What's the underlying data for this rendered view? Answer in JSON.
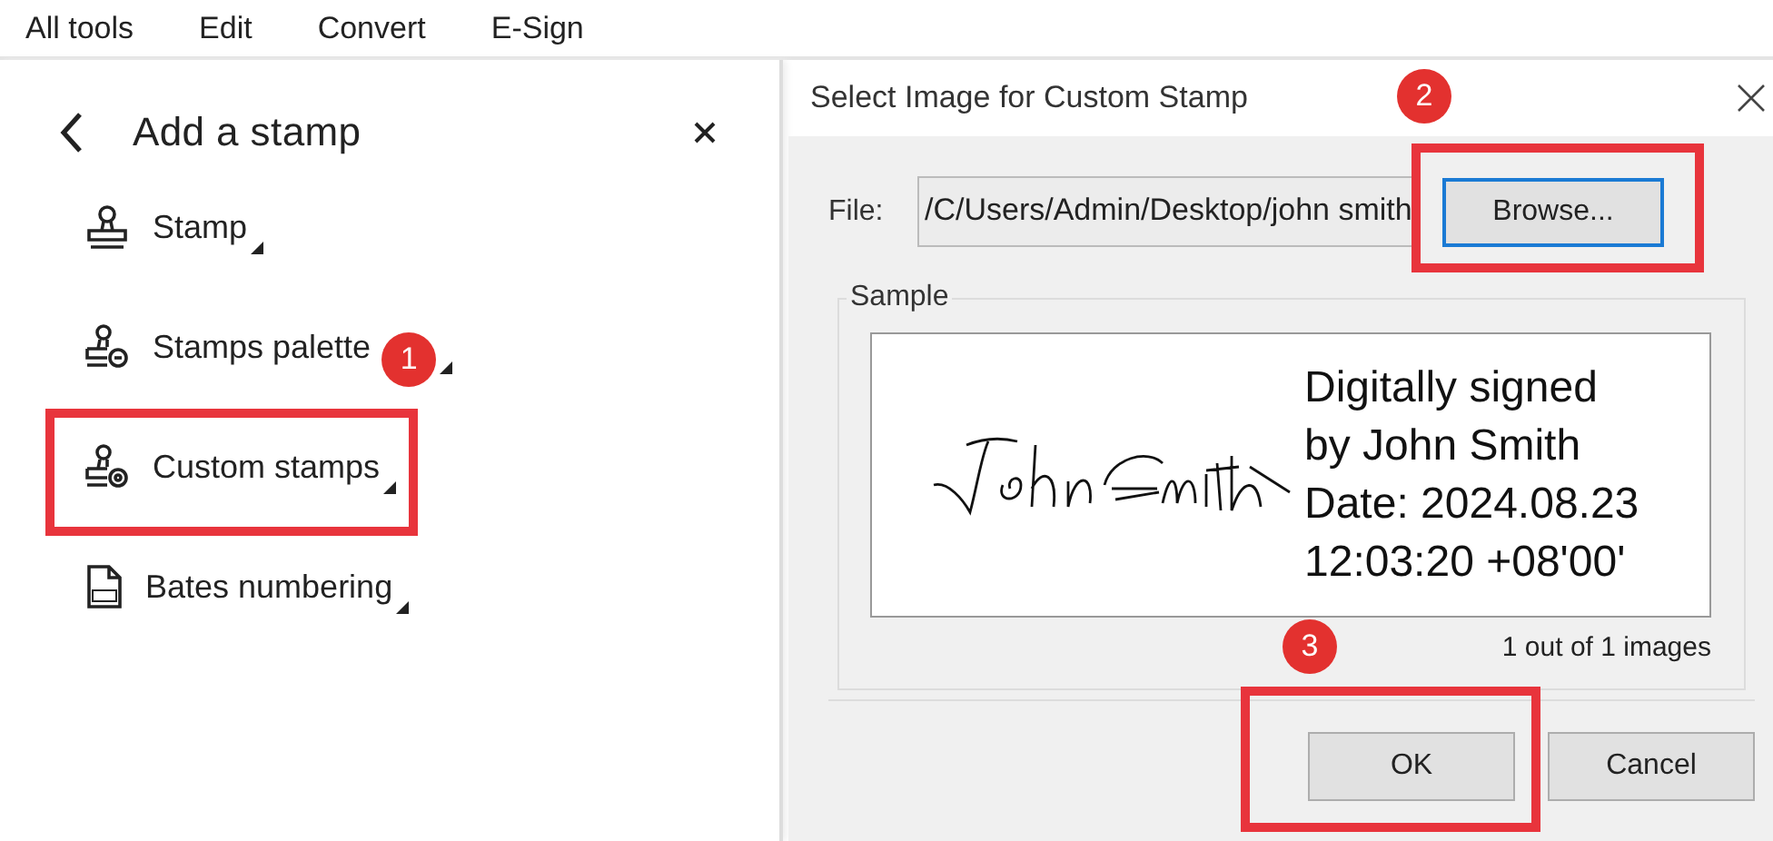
{
  "menu": [
    {
      "label": "All tools"
    },
    {
      "label": "Edit"
    },
    {
      "label": "Convert"
    },
    {
      "label": "E-Sign"
    }
  ],
  "panel": {
    "title": "Add a stamp",
    "items": [
      {
        "label": "Stamp",
        "kind": "stamp",
        "highlighted": false
      },
      {
        "label": "Stamps palette",
        "kind": "palette",
        "highlighted": false,
        "badge": "1"
      },
      {
        "label": "Custom stamps",
        "kind": "custom",
        "highlighted": true
      },
      {
        "label": "Bates numbering",
        "kind": "bates",
        "highlighted": false
      }
    ]
  },
  "dialog": {
    "title": "Select Image for Custom Stamp",
    "file_label": "File:",
    "file_value": "/C/Users/Admin/Desktop/john smith",
    "sample_label": "Sample",
    "stamp_lines": [
      "Digitally signed",
      "by John Smith",
      "Date: 2024.08.23",
      "12:03:20 +08'00'"
    ],
    "counter": "1 out of 1 images",
    "browse": {
      "label": "Browse...",
      "highlighted": true,
      "badge": "2"
    },
    "buttons": [
      {
        "label": "OK",
        "highlighted": true,
        "badge": "3"
      },
      {
        "label": "Cancel",
        "highlighted": false
      }
    ]
  }
}
